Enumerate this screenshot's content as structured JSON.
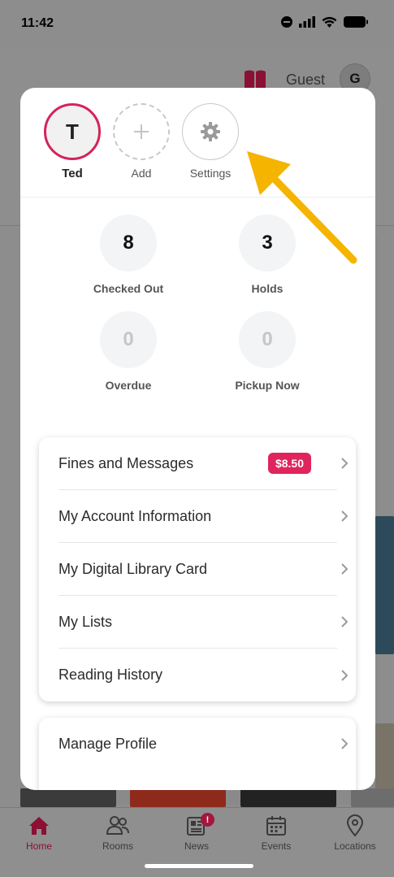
{
  "status": {
    "time": "11:42"
  },
  "background": {
    "guest_label": "Guest",
    "avatar_initial": "G"
  },
  "profiles": [
    {
      "name": "Ted",
      "initial": "T"
    },
    {
      "name": "Add"
    },
    {
      "name": "Settings"
    }
  ],
  "stats": [
    {
      "value": "8",
      "label": "Checked Out"
    },
    {
      "value": "3",
      "label": "Holds"
    },
    {
      "value": "0",
      "label": "Overdue"
    },
    {
      "value": "0",
      "label": "Pickup Now"
    }
  ],
  "menu": [
    {
      "label": "Fines and Messages",
      "badge": "$8.50"
    },
    {
      "label": "My Account Information"
    },
    {
      "label": "My Digital Library Card"
    },
    {
      "label": "My Lists"
    },
    {
      "label": "Reading History"
    }
  ],
  "menu2": [
    {
      "label": "Manage Profile"
    }
  ],
  "nav": [
    {
      "label": "Home",
      "icon": "home-icon",
      "active": true
    },
    {
      "label": "Rooms",
      "icon": "people-icon"
    },
    {
      "label": "News",
      "icon": "newspaper-icon",
      "badge": "!"
    },
    {
      "label": "Events",
      "icon": "calendar-icon"
    },
    {
      "label": "Locations",
      "icon": "location-pin-icon"
    }
  ],
  "colors": {
    "accent": "#d4235a",
    "badge": "#e0245e",
    "arrow": "#f5b400"
  }
}
